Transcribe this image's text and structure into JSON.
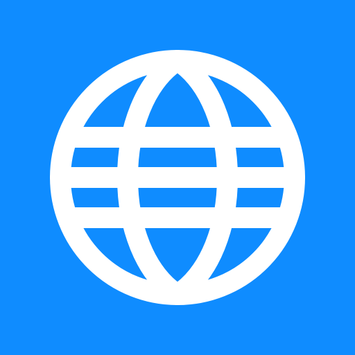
{
  "app_icon": {
    "icon": "globe-icon",
    "background_color": "#0F8CFF",
    "foreground_color": "#FFFFFF"
  }
}
